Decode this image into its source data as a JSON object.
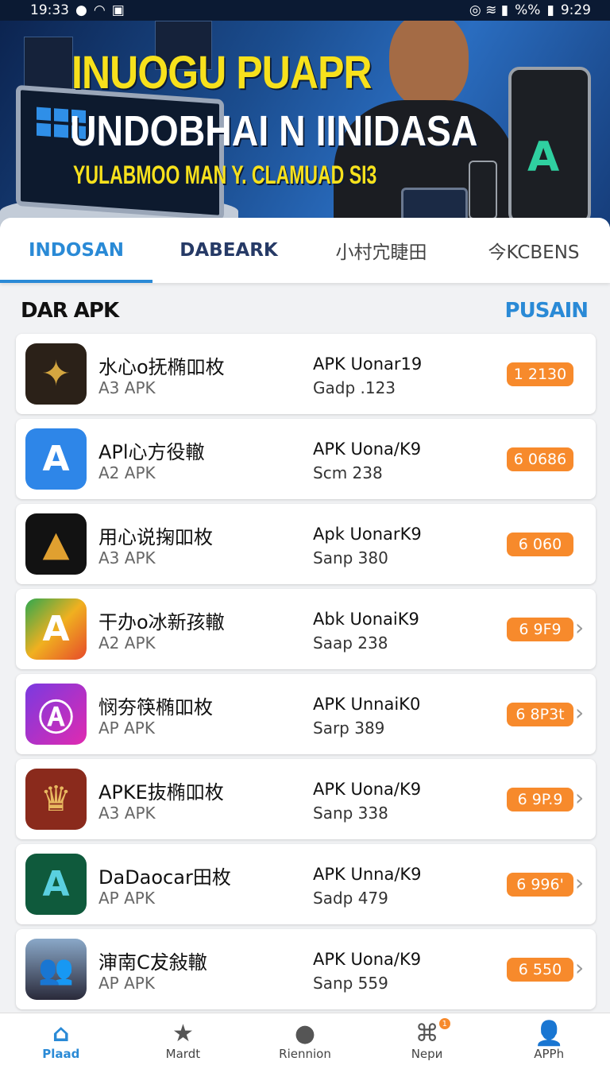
{
  "status": {
    "time_left": "19:33",
    "time_right": "9:29",
    "battery_text": "%%"
  },
  "banner": {
    "title_line1": "INUOGU PUAPR",
    "title_line2": "UNDOBHAI N IINIDASA",
    "title_line3": "YULABMOO MAN Y. CLAMUAD SI3"
  },
  "tabs": [
    {
      "label": "INDOSAN"
    },
    {
      "label": "DABEARK"
    },
    {
      "label": "小村宂睫田"
    },
    {
      "label": "今KCBENS"
    }
  ],
  "section": {
    "title": "DAR APK",
    "action": "PUSAIN"
  },
  "apps": [
    {
      "name": "水心o抚椭吅枚",
      "sub": "A3 APK",
      "version": "APK Uonar19",
      "size": "Gadp .123",
      "badge": "1 2130",
      "icon": "star-emblem-icon",
      "icon_bg": "#2b2118",
      "chevron": false
    },
    {
      "name": "APl心方役轍",
      "sub": "A2 APK",
      "version": "APK Uona/K9",
      "size": "Scm 238",
      "badge": "6 0686",
      "icon": "app-store-a-icon",
      "icon_bg": "#2e86e8",
      "chevron": false
    },
    {
      "name": "用心说掬吅枚",
      "sub": "A3 APK",
      "version": "Apk UonarK9",
      "size": "Sanp 380",
      "badge": "6 060",
      "icon": "gold-arrow-icon",
      "icon_bg": "#121212",
      "chevron": false
    },
    {
      "name": "干办o冰新孩轍",
      "sub": "A2 APK",
      "version": "Abk UonaiK9",
      "size": "Saap 238",
      "badge": "6 9F9",
      "icon": "triangle-a-icon",
      "icon_bg": "#2fa84f",
      "chevron": true
    },
    {
      "name": "悯夯筷椭吅枚",
      "sub": "AP APK",
      "version": "APK UnnaiK0",
      "size": "Sarp 389",
      "badge": "6 8P3t",
      "icon": "circle-a-icon",
      "icon_bg": "#b42ed0",
      "chevron": true
    },
    {
      "name": "APKE抜椭吅枚",
      "sub": "A3 APK",
      "version": "APK Uona/K9",
      "size": "Sanp 338",
      "badge": "6 9P.9",
      "icon": "lion-crest-icon",
      "icon_bg": "#8a2a1c",
      "chevron": true
    },
    {
      "name": "DaDaocar田枚",
      "sub": "AP APK",
      "version": "APK Unna/K9",
      "size": "Sadp 479",
      "badge": "6 996'",
      "icon": "green-a-icon",
      "icon_bg": "#0f5a3c",
      "chevron": true
    },
    {
      "name": "渖南C犮敍轍",
      "sub": "AP APK",
      "version": "APK Uona/K9",
      "size": "Sanp 559",
      "badge": "6 550",
      "icon": "people-photo-icon",
      "icon_bg": "#6a8ab0",
      "chevron": true
    }
  ],
  "nav": [
    {
      "label": "Plaad",
      "icon": "home-icon"
    },
    {
      "label": "Mardt",
      "icon": "star-icon"
    },
    {
      "label": "Riennion",
      "icon": "drop-icon"
    },
    {
      "label": "Nepи",
      "icon": "map-icon",
      "badge": "1"
    },
    {
      "label": "APPh",
      "icon": "person-icon"
    }
  ],
  "colors": {
    "accent": "#2a8ad6",
    "badge": "#f78a2c",
    "banner_yellow": "#f7e11c"
  }
}
